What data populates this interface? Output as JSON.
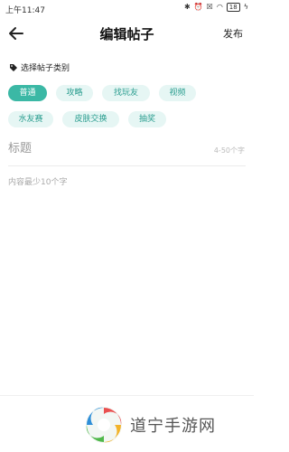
{
  "status_bar": {
    "time": "上午11:47",
    "battery": "18"
  },
  "header": {
    "title": "编辑帖子",
    "publish_label": "发布"
  },
  "category": {
    "label": "选择帖子类别",
    "chips": [
      {
        "label": "普通",
        "selected": true
      },
      {
        "label": "攻略",
        "selected": false
      },
      {
        "label": "找玩友",
        "selected": false
      },
      {
        "label": "视频",
        "selected": false
      },
      {
        "label": "水友赛",
        "selected": false
      },
      {
        "label": "皮肤交换",
        "selected": false
      },
      {
        "label": "抽奖",
        "selected": false
      }
    ]
  },
  "editor": {
    "title_placeholder": "标题",
    "title_counter": "4-50个字",
    "content_placeholder": "内容最少10个字"
  },
  "watermark": {
    "text": "道宁手游网"
  },
  "colors": {
    "accent": "#3bb8a5",
    "chip_bg": "#e6f6f4",
    "chip_text": "#2a9d8f"
  }
}
